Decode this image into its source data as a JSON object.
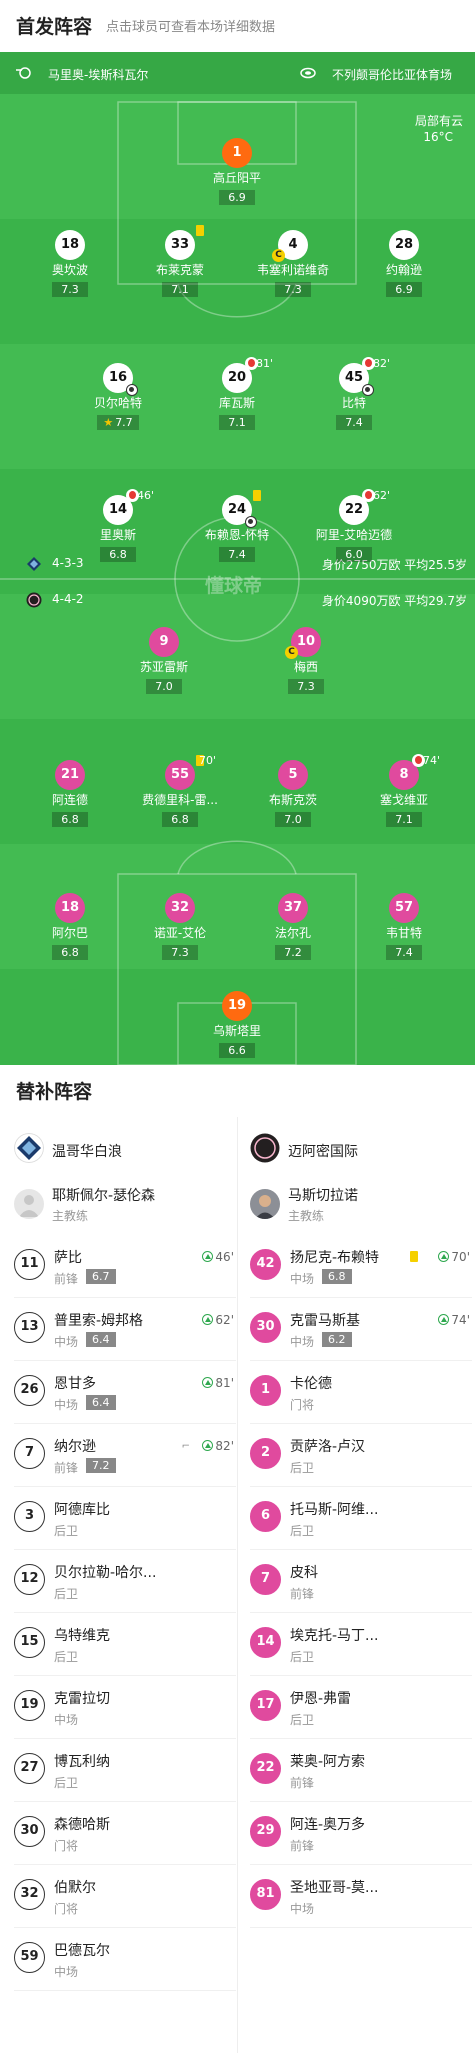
{
  "header": {
    "title": "首发阵容",
    "hint": "点击球员可查看本场详细数据"
  },
  "match_info": {
    "referee": "马里奥-埃斯科瓦尔",
    "venue": "不列颠哥伦比亚体育场",
    "weather": "局部有云",
    "temperature": "16°C",
    "watermark": "懂球帝"
  },
  "home_formation": {
    "shape": "4-3-3",
    "value": "身价2750万欧 平均25.5岁"
  },
  "away_formation": {
    "shape": "4-4-2",
    "value": "身价4090万欧 平均29.7岁"
  },
  "home_players": [
    {
      "number": "1",
      "name": "高丘阳平",
      "rating": "6.9",
      "gk": true
    },
    {
      "number": "18",
      "name": "奥坎波",
      "rating": "7.3"
    },
    {
      "number": "33",
      "name": "布莱克蒙",
      "rating": "7.1",
      "yellow": true
    },
    {
      "number": "4",
      "name": "韦塞利诺维奇",
      "rating": "7.3",
      "captain": true
    },
    {
      "number": "28",
      "name": "约翰逊",
      "rating": "6.9"
    },
    {
      "number": "16",
      "name": "贝尔哈特",
      "rating": "7.7",
      "star": true,
      "goal": true
    },
    {
      "number": "20",
      "name": "库瓦斯",
      "rating": "7.1",
      "sub_off": "81'"
    },
    {
      "number": "45",
      "name": "比特",
      "rating": "7.4",
      "sub_off": "82'",
      "assist": true
    },
    {
      "number": "14",
      "name": "里奥斯",
      "rating": "6.8",
      "sub_off": "46'"
    },
    {
      "number": "24",
      "name": "布赖恩-怀特",
      "rating": "7.4",
      "yellow": true,
      "goal": true
    },
    {
      "number": "22",
      "name": "阿里-艾哈迈德",
      "rating": "6.0",
      "sub_off": "62'"
    }
  ],
  "away_players": [
    {
      "number": "9",
      "name": "苏亚雷斯",
      "rating": "7.0"
    },
    {
      "number": "10",
      "name": "梅西",
      "rating": "7.3",
      "captain": true
    },
    {
      "number": "21",
      "name": "阿连德",
      "rating": "6.8"
    },
    {
      "number": "55",
      "name": "费德里科-雷...",
      "rating": "6.8",
      "yellow": true,
      "sub_off": "70'"
    },
    {
      "number": "5",
      "name": "布斯克茨",
      "rating": "7.0"
    },
    {
      "number": "8",
      "name": "塞戈维亚",
      "rating": "7.1",
      "sub_off": "74'"
    },
    {
      "number": "18",
      "name": "阿尔巴",
      "rating": "6.8"
    },
    {
      "number": "32",
      "name": "诺亚-艾伦",
      "rating": "7.3"
    },
    {
      "number": "37",
      "name": "法尔孔",
      "rating": "7.2"
    },
    {
      "number": "57",
      "name": "韦甘特",
      "rating": "7.4"
    },
    {
      "number": "19",
      "name": "乌斯塔里",
      "rating": "6.6",
      "gk": true
    }
  ],
  "subs": {
    "title": "替补阵容",
    "home_team": "温哥华白浪",
    "away_team": "迈阿密国际",
    "home_coach": {
      "name": "耶斯佩尔-瑟伦森",
      "role": "主教练"
    },
    "away_coach": {
      "name": "马斯切拉诺",
      "role": "主教练"
    },
    "home": [
      {
        "number": "11",
        "name": "萨比",
        "pos": "前锋",
        "rating": "6.7",
        "time": "46'"
      },
      {
        "number": "13",
        "name": "普里索-姆邦格",
        "pos": "中场",
        "rating": "6.4",
        "time": "62'"
      },
      {
        "number": "26",
        "name": "恩甘多",
        "pos": "中场",
        "rating": "6.4",
        "time": "81'"
      },
      {
        "number": "7",
        "name": "纳尔逊",
        "pos": "前锋",
        "rating": "7.2",
        "time": "82'",
        "assist": true
      },
      {
        "number": "3",
        "name": "阿德库比",
        "pos": "后卫"
      },
      {
        "number": "12",
        "name": "贝尔拉勒-哈尔...",
        "pos": "后卫"
      },
      {
        "number": "15",
        "name": "乌特维克",
        "pos": "后卫"
      },
      {
        "number": "19",
        "name": "克雷拉切",
        "pos": "中场"
      },
      {
        "number": "27",
        "name": "博瓦利纳",
        "pos": "后卫"
      },
      {
        "number": "30",
        "name": "森德哈斯",
        "pos": "门将"
      },
      {
        "number": "32",
        "name": "伯默尔",
        "pos": "门将"
      },
      {
        "number": "59",
        "name": "巴德瓦尔",
        "pos": "中场"
      }
    ],
    "away": [
      {
        "number": "42",
        "name": "扬尼克-布赖特",
        "pos": "中场",
        "rating": "6.8",
        "time": "70'",
        "yellow": true
      },
      {
        "number": "30",
        "name": "克雷马斯基",
        "pos": "中场",
        "rating": "6.2",
        "time": "74'"
      },
      {
        "number": "1",
        "name": "卡伦德",
        "pos": "门将"
      },
      {
        "number": "2",
        "name": "贡萨洛-卢汉",
        "pos": "后卫"
      },
      {
        "number": "6",
        "name": "托马斯-阿维...",
        "pos": "后卫"
      },
      {
        "number": "7",
        "name": "皮科",
        "pos": "前锋"
      },
      {
        "number": "14",
        "name": "埃克托-马丁...",
        "pos": "后卫"
      },
      {
        "number": "17",
        "name": "伊恩-弗雷",
        "pos": "后卫"
      },
      {
        "number": "22",
        "name": "莱奥-阿方索",
        "pos": "前锋"
      },
      {
        "number": "29",
        "name": "阿连-奥万多",
        "pos": "前锋"
      },
      {
        "number": "81",
        "name": "圣地亚哥-莫...",
        "pos": "中场"
      }
    ]
  }
}
